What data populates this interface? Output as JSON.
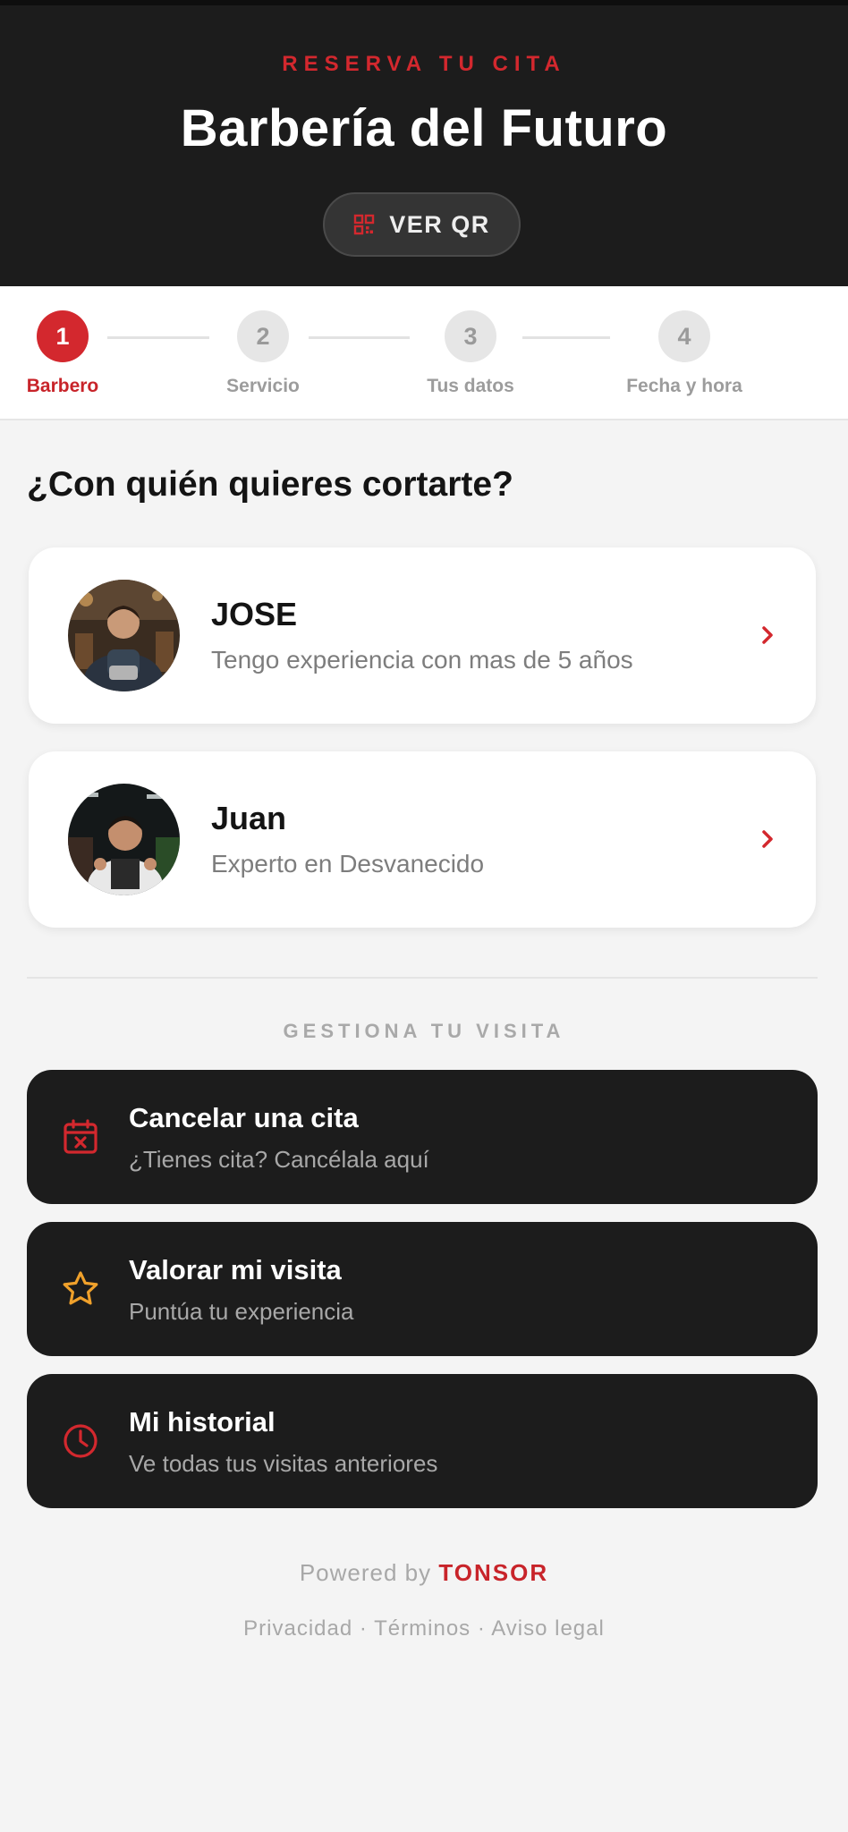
{
  "header": {
    "eyebrow": "RESERVA TU CITA",
    "title": "Barbería del Futuro",
    "qr_button": "VER QR"
  },
  "stepper": {
    "current_step": 1,
    "steps": [
      {
        "number": "1",
        "label": "Barbero"
      },
      {
        "number": "2",
        "label": "Servicio"
      },
      {
        "number": "3",
        "label": "Tus datos"
      },
      {
        "number": "4",
        "label": "Fecha y hora"
      }
    ]
  },
  "barbers": {
    "heading": "¿Con quién quieres cortarte?",
    "items": [
      {
        "name": "JOSE",
        "description": "Tengo experiencia con mas de 5 años"
      },
      {
        "name": "Juan",
        "description": "Experto en Desvanecido"
      }
    ]
  },
  "manage": {
    "heading": "GESTIONA TU VISITA",
    "actions": [
      {
        "title": "Cancelar una cita",
        "subtitle": "¿Tienes cita? Cancélala aquí",
        "icon": "calendar-x-icon"
      },
      {
        "title": "Valorar mi visita",
        "subtitle": "Puntúa tu experiencia",
        "icon": "star-icon"
      },
      {
        "title": "Mi historial",
        "subtitle": "Ve todas tus visitas anteriores",
        "icon": "clock-icon"
      }
    ]
  },
  "footer": {
    "powered_by": "Powered by",
    "brand": "TONSOR",
    "links": [
      "Privacidad",
      "Términos",
      "Aviso legal"
    ],
    "separator": "·"
  },
  "colors": {
    "accent": "#d3282e",
    "dark": "#1c1c1c",
    "star": "#f0a12b"
  }
}
